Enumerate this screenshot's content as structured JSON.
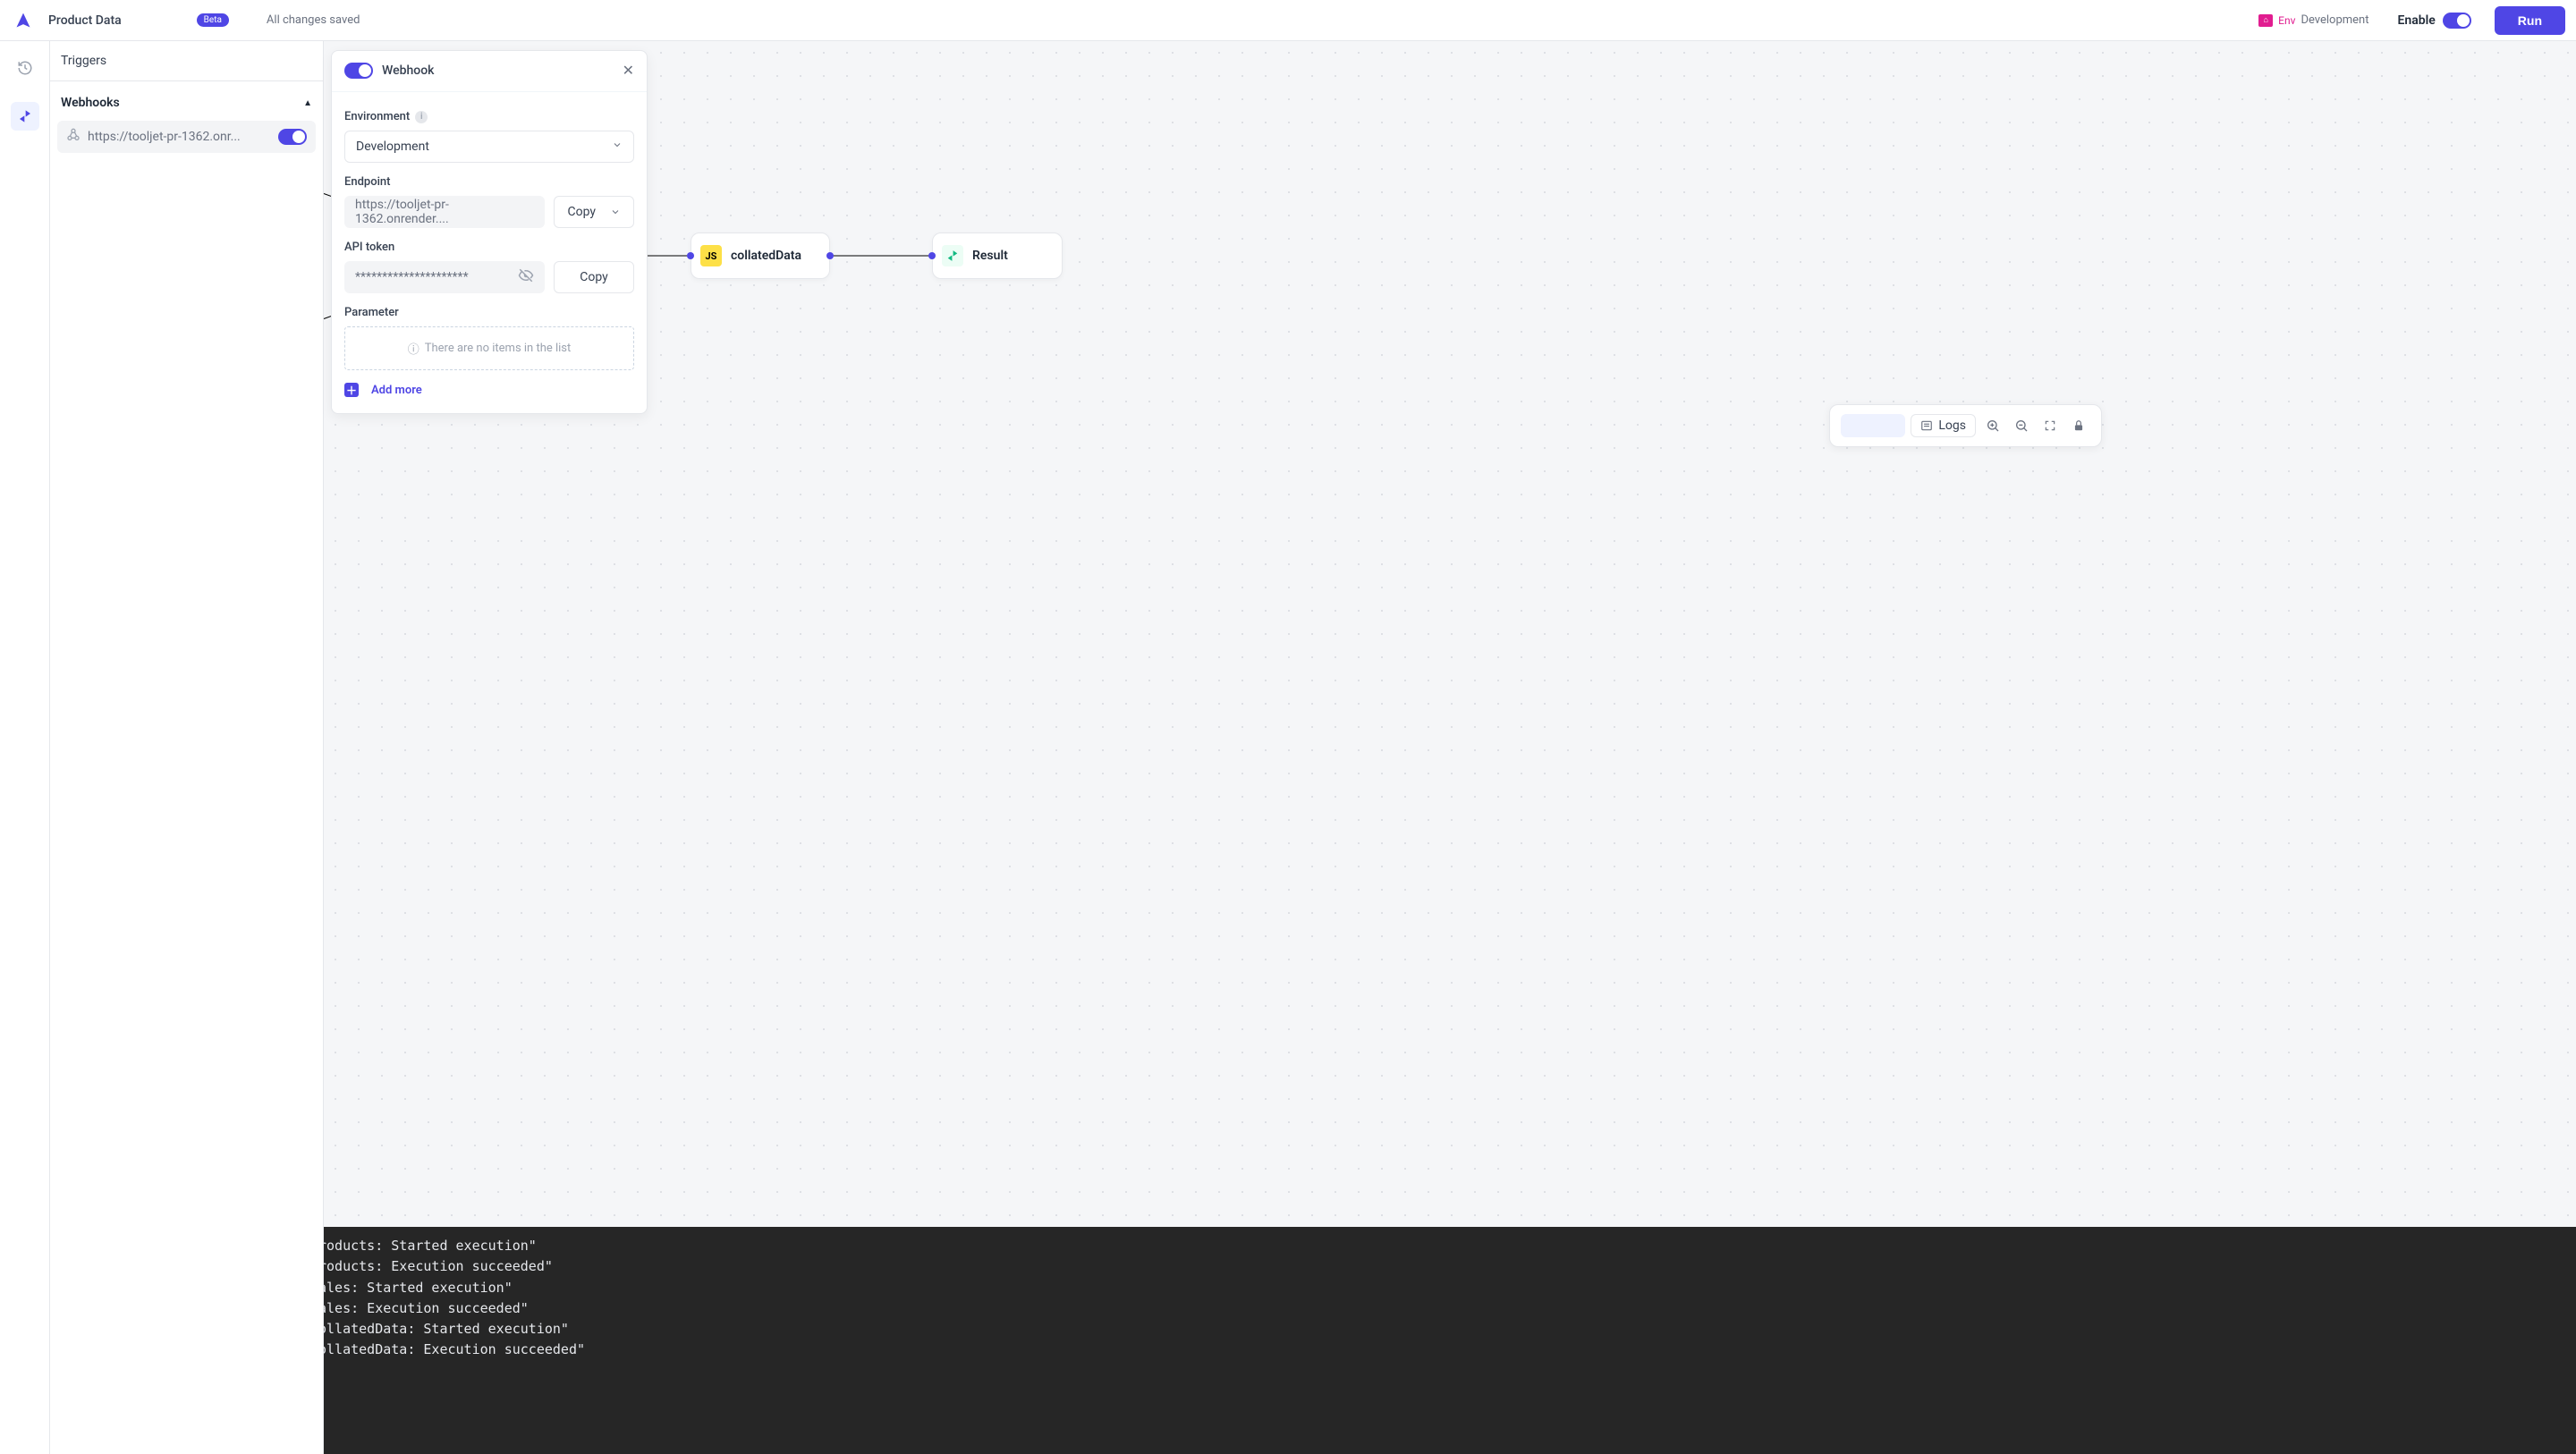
{
  "header": {
    "title": "Product Data",
    "badge": "Beta",
    "saved": "All changes saved",
    "env_label": "Env",
    "env_value": "Development",
    "enable_label": "Enable",
    "run_label": "Run"
  },
  "sidebar": {
    "triggers_label": "Triggers",
    "webhooks_label": "Webhooks",
    "webhook_item_url": "https://tooljet-pr-1362.onr..."
  },
  "config": {
    "title": "Webhook",
    "environment_label": "Environment",
    "environment_value": "Development",
    "endpoint_label": "Endpoint",
    "endpoint_value": "https://tooljet-pr-1362.onrender....",
    "copy_label": "Copy",
    "api_token_label": "API token",
    "api_token_mask": "*********************",
    "parameter_label": "Parameter",
    "empty_text": "There are no items in the list",
    "add_more": "Add more"
  },
  "nodes": {
    "collated": "collatedData",
    "result": "Result"
  },
  "toolbar": {
    "logs": "Logs"
  },
  "logs": [
    "roducts: Started execution\"",
    "roducts: Execution succeeded\"",
    "ales: Started execution\"",
    "ales: Execution succeeded\"",
    "ollatedData: Started execution\"",
    "ollatedData: Execution succeeded\""
  ]
}
